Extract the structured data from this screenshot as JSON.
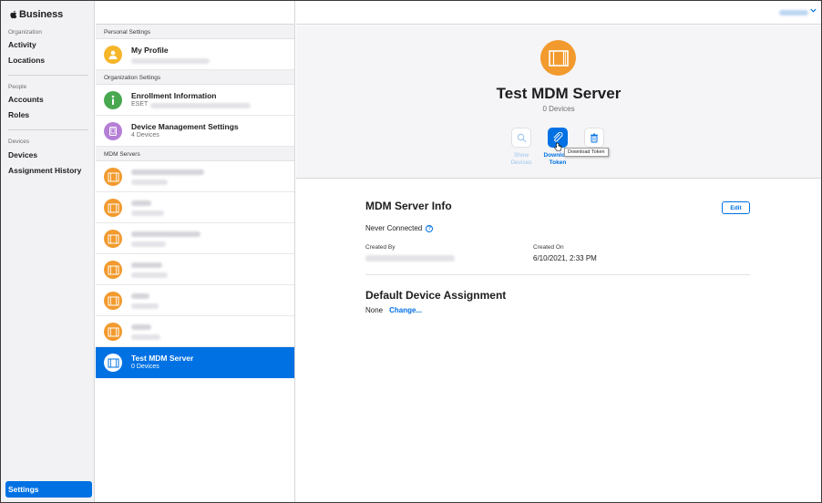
{
  "app": {
    "brand": "Business"
  },
  "nav": {
    "sections": [
      {
        "label": "Organization",
        "items": [
          "Activity",
          "Locations"
        ]
      },
      {
        "label": "People",
        "items": [
          "Accounts",
          "Roles"
        ]
      },
      {
        "label": "Devices",
        "items": [
          "Devices",
          "Assignment History"
        ]
      }
    ],
    "settings": "Settings"
  },
  "list": {
    "personal_header": "Personal Settings",
    "my_profile": "My Profile",
    "org_header": "Organization Settings",
    "enrollment_title": "Enrollment Information",
    "enrollment_sub": "ESET",
    "dms_title": "Device Management Settings",
    "dms_sub": "4 Devices",
    "mdm_header": "MDM Servers",
    "selected_title": "Test MDM Server",
    "selected_sub": "0 Devices"
  },
  "detail": {
    "title": "Test MDM Server",
    "subtitle": "0 Devices",
    "actions": {
      "show_devices": "Show\nDevices",
      "download_token": "Download\nToken",
      "tooltip": "Download Token"
    },
    "info_heading": "MDM Server Info",
    "edit": "Edit",
    "status": "Never Connected",
    "created_by_label": "Created By",
    "created_on_label": "Created On",
    "created_on_value": "6/10/2021, 2:33 PM",
    "assignment_heading": "Default Device Assignment",
    "assignment_value": "None",
    "change": "Change..."
  },
  "colors": {
    "accent": "#0071e3",
    "server_orange": "#f29a2e",
    "enrollment_green": "#48a84f",
    "dms_purple": "#b57fd6",
    "profile_yellow": "#f6b62a"
  },
  "icons": [
    "apple-logo-icon",
    "profile-icon",
    "info-icon",
    "device-icon",
    "server-icon",
    "search-icon",
    "download-token-icon",
    "trash-icon",
    "help-icon",
    "chevron-down-icon",
    "cursor-icon"
  ]
}
